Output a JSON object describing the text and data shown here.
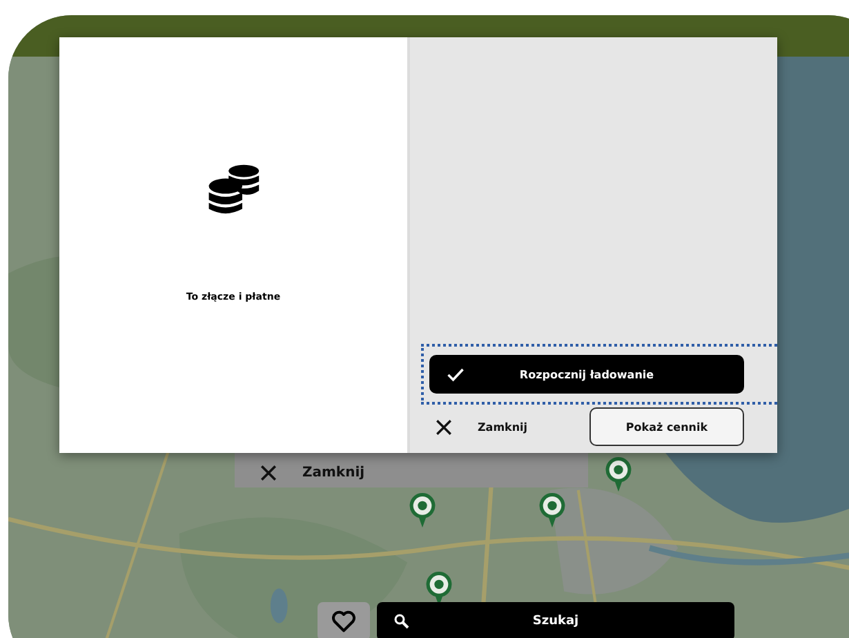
{
  "dialog": {
    "info": {
      "text": "To złącze i płatne"
    },
    "actions": {
      "primary": {
        "label": "Rozpocznij ładowanie",
        "focused": true
      },
      "close": {
        "label": "Zamknij"
      },
      "secondary": {
        "label": "Pokaż cennik"
      }
    }
  },
  "background_panel": {
    "close_label": "Zamknij"
  },
  "bottom_bar": {
    "search_button": {
      "label": "Szukaj"
    }
  }
}
